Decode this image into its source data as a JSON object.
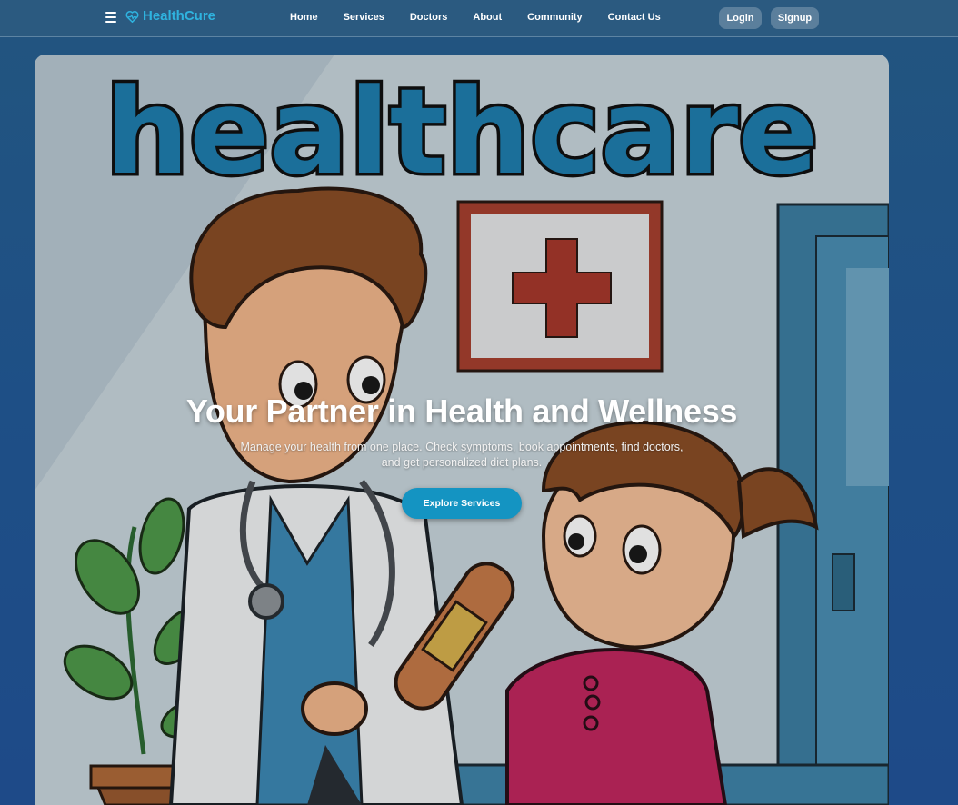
{
  "nav": {
    "brand": "HealthCure",
    "links": [
      "Home",
      "Services",
      "Doctors",
      "About",
      "Community",
      "Contact Us"
    ],
    "login_label": "Login",
    "signup_label": "Signup"
  },
  "hero": {
    "image_text": "healthcare",
    "title": "Your Partner in Health and Wellness",
    "subtitle": "Manage your health from one place. Check symptoms, book appointments, find doctors, and get personalized diet plans.",
    "cta_label": "Explore Services"
  },
  "colors": {
    "brand": "#2fb3df",
    "cta": "#1494c2",
    "nav_bg": "#2b5a80",
    "page_bg": "#1e4f86"
  },
  "icons": {
    "menu": "hamburger-icon",
    "logo": "heart-pulse-icon"
  }
}
